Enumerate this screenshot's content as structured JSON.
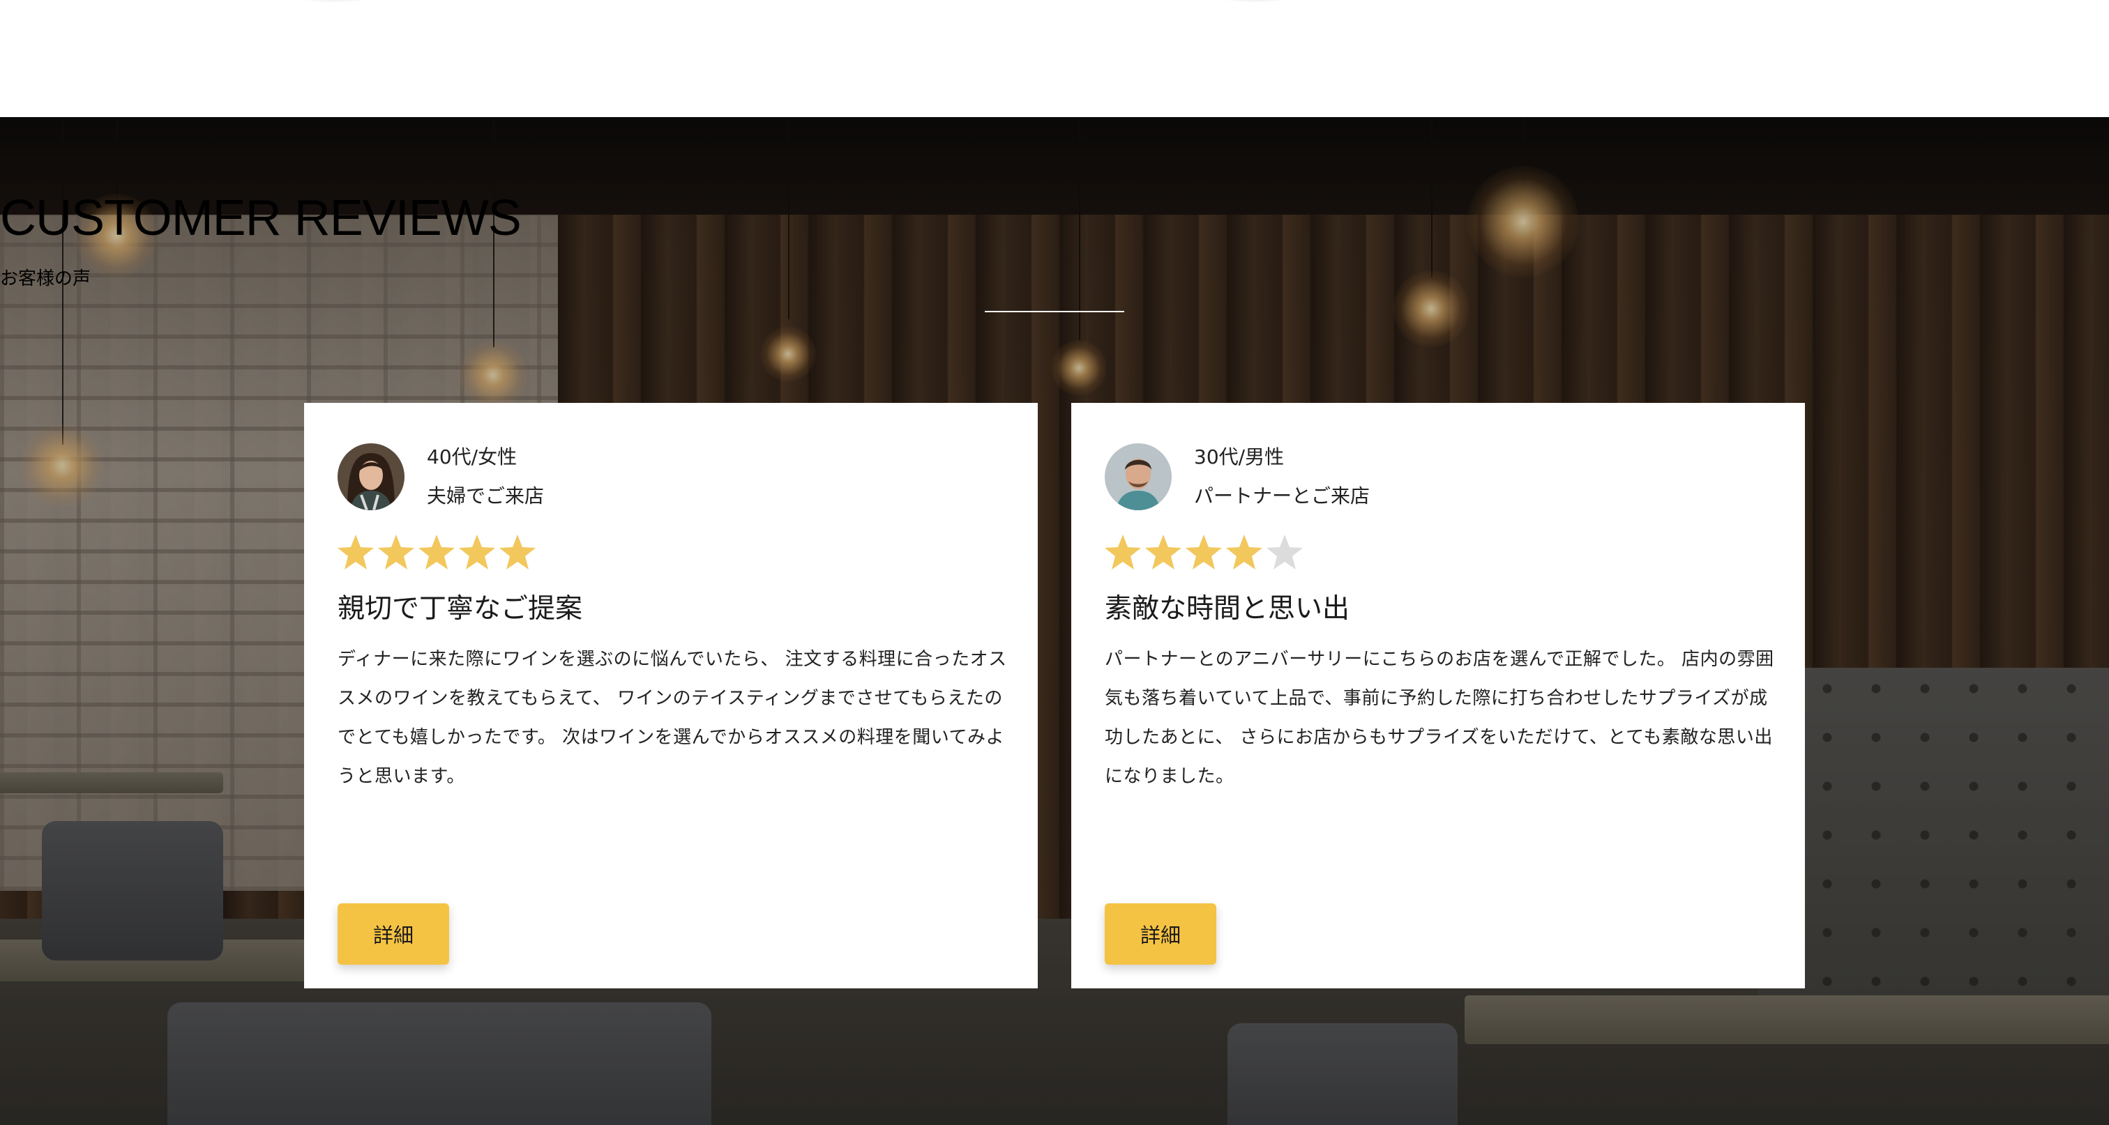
{
  "colors": {
    "accent": "#f5c343",
    "star_filled": "#f2c75c",
    "star_empty": "#dcdcdc",
    "card_background": "#ffffff",
    "heading_text": "#ffffff"
  },
  "section": {
    "title": "CUSTOMER REVIEWS",
    "subtitle": "お客様の声"
  },
  "reviews": [
    {
      "avatar": "woman-avatar",
      "age_gender": "40代/女性",
      "visit_type": "夫婦でご来店",
      "rating": 5,
      "rating_max": 5,
      "title": "親切で丁寧なご提案",
      "body": "ディナーに来た際にワインを選ぶのに悩んでいたら、 注文する料理に合ったオススメのワインを教えてもらえて、 ワインのテイスティングまでさせてもらえたのでとても嬉しかったです。 次はワインを選んでからオススメの料理を聞いてみようと思います。",
      "button_label": "詳細"
    },
    {
      "avatar": "man-avatar",
      "age_gender": "30代/男性",
      "visit_type": "パートナーとご来店",
      "rating": 4,
      "rating_max": 5,
      "title": "素敵な時間と思い出",
      "body": "パートナーとのアニバーサリーにこちらのお店を選んで正解でした。 店内の雰囲気も落ち着いていて上品で、事前に予約した際に打ち合わせしたサプライズが成功したあとに、 さらにお店からもサプライズをいただけて、とても素敵な思い出になりました。",
      "button_label": "詳細"
    }
  ]
}
